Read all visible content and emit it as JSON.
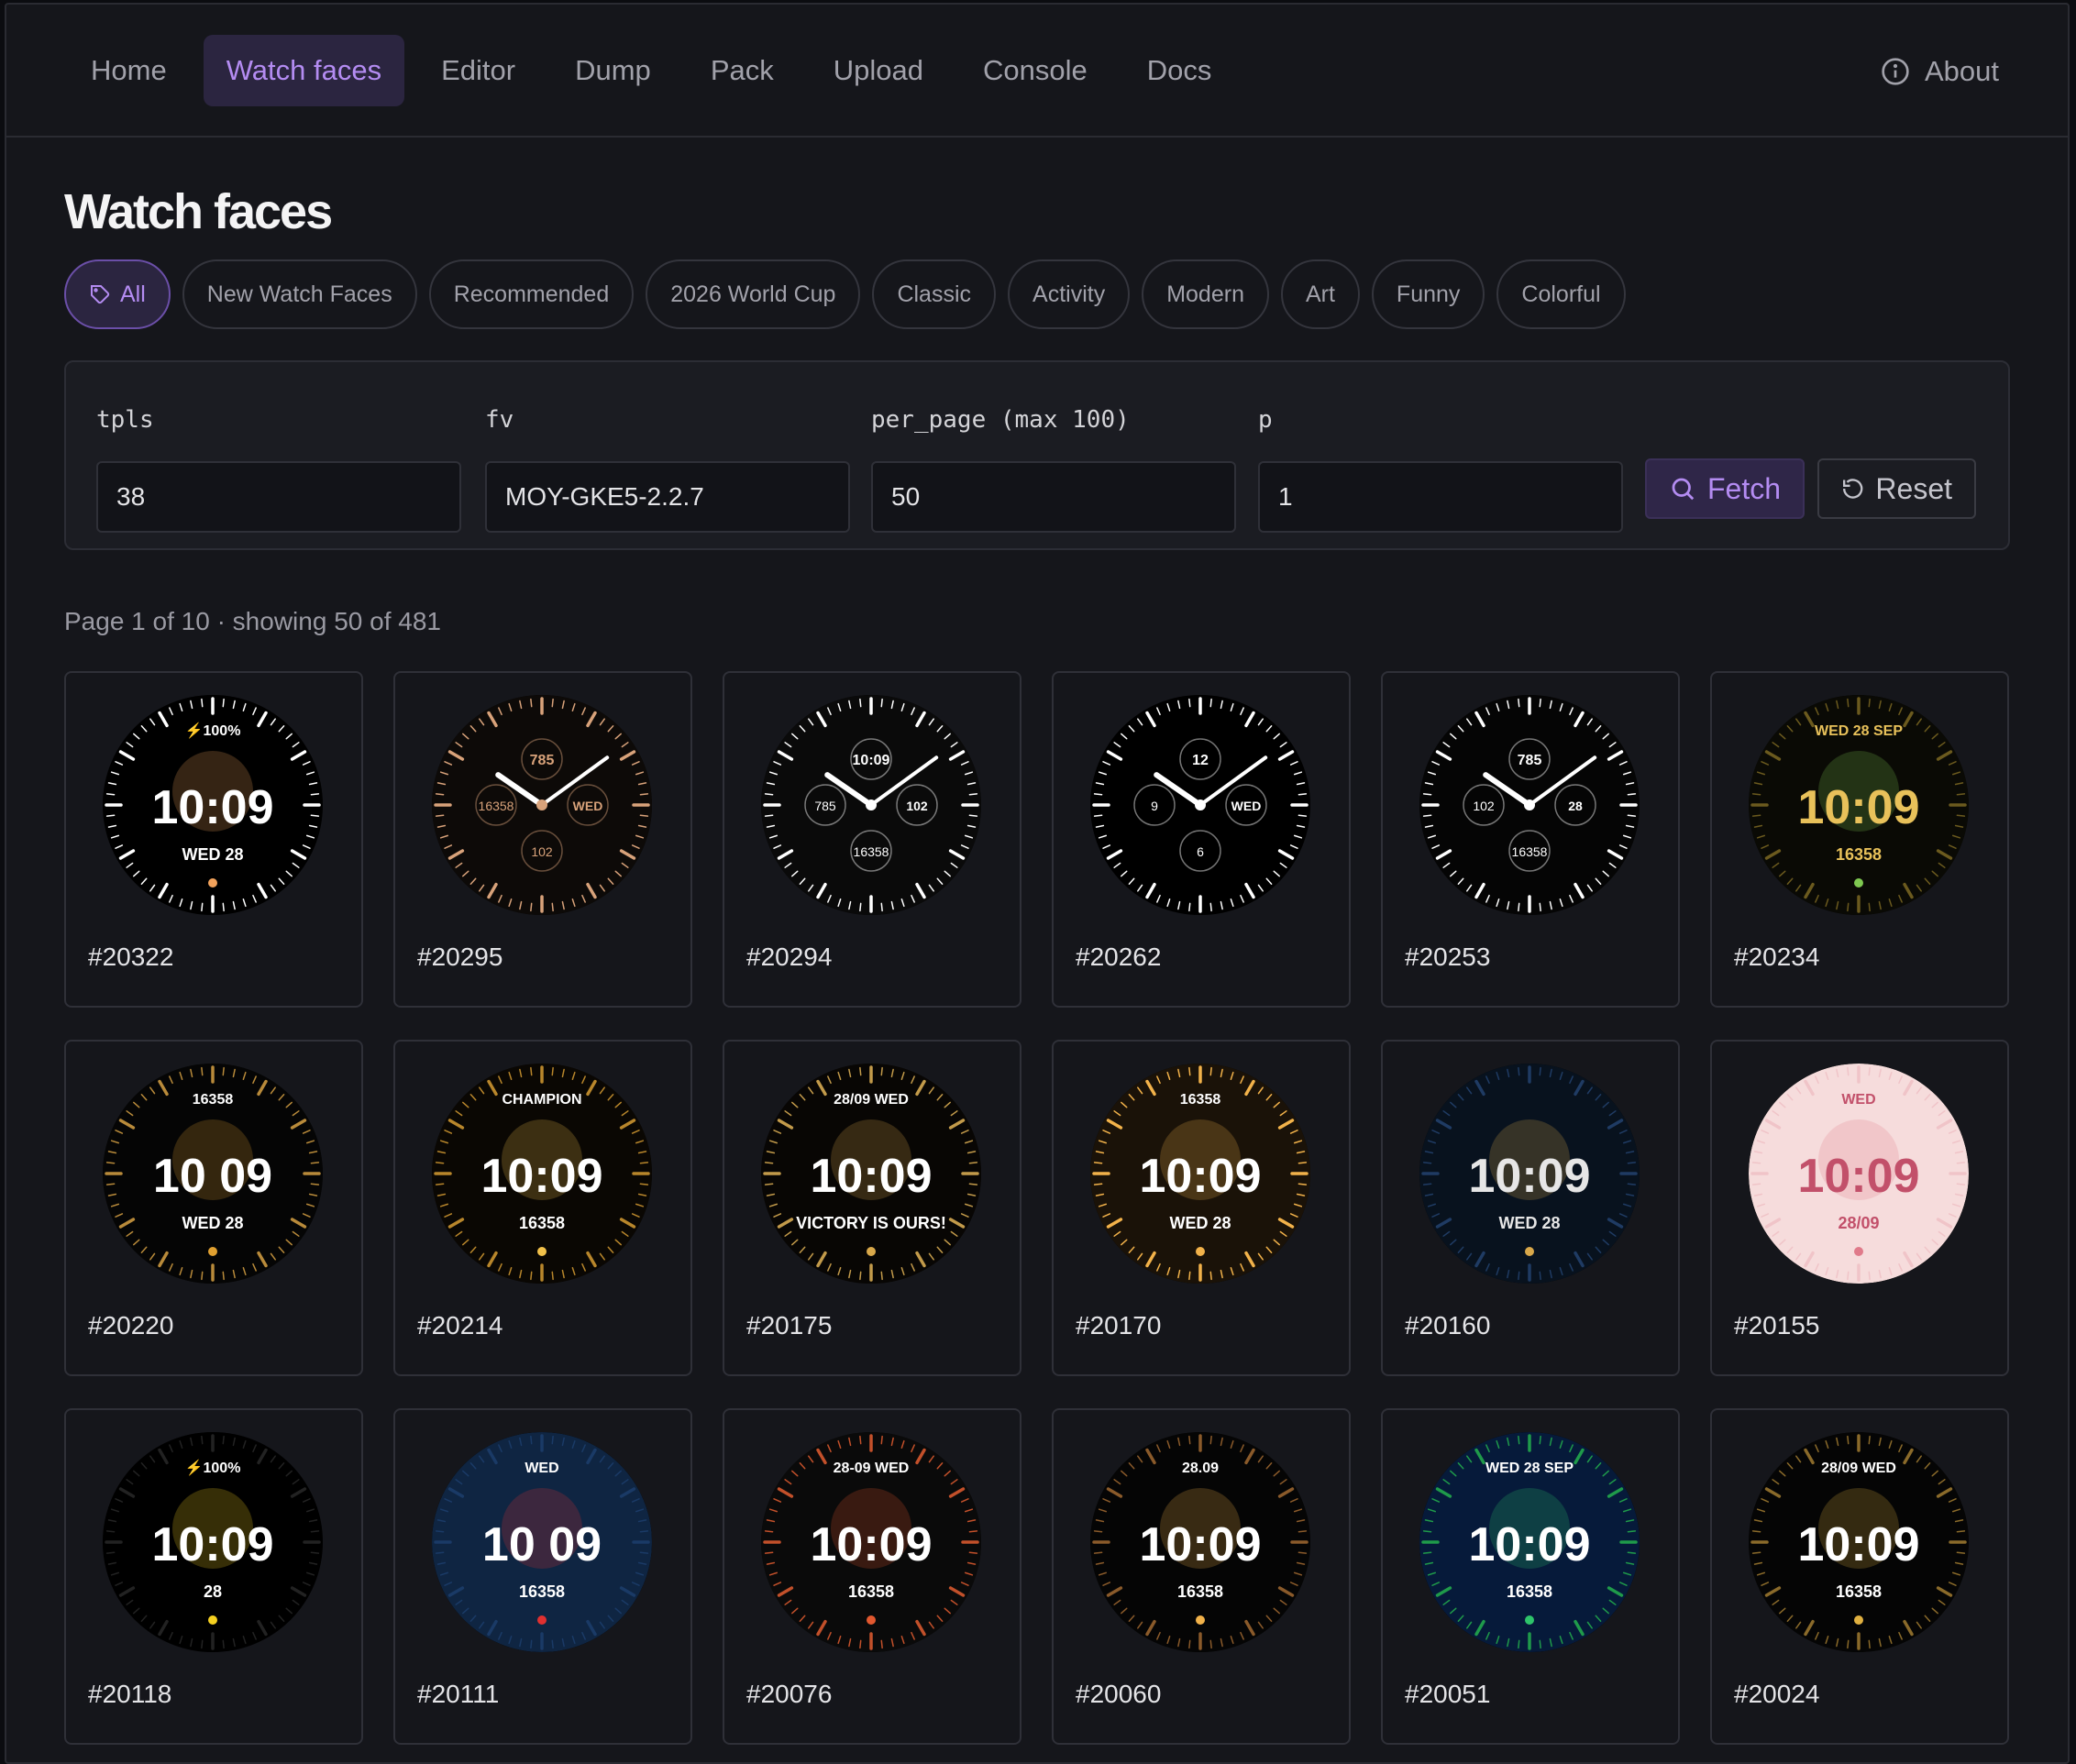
{
  "nav": {
    "items": [
      {
        "label": "Home",
        "active": false
      },
      {
        "label": "Watch faces",
        "active": true
      },
      {
        "label": "Editor",
        "active": false
      },
      {
        "label": "Dump",
        "active": false
      },
      {
        "label": "Pack",
        "active": false
      },
      {
        "label": "Upload",
        "active": false
      },
      {
        "label": "Console",
        "active": false
      },
      {
        "label": "Docs",
        "active": false
      }
    ],
    "about": "About"
  },
  "page": {
    "title": "Watch faces",
    "info": "Page 1 of 10 · showing 50 of 481"
  },
  "chips": [
    {
      "label": "All",
      "active": true
    },
    {
      "label": "New Watch Faces",
      "active": false
    },
    {
      "label": "Recommended",
      "active": false
    },
    {
      "label": "2026 World Cup",
      "active": false
    },
    {
      "label": "Classic",
      "active": false
    },
    {
      "label": "Activity",
      "active": false
    },
    {
      "label": "Modern",
      "active": false
    },
    {
      "label": "Art",
      "active": false
    },
    {
      "label": "Funny",
      "active": false
    },
    {
      "label": "Colorful",
      "active": false
    }
  ],
  "filters": {
    "tpls": {
      "label": "tpls",
      "value": "38"
    },
    "fv": {
      "label": "fv",
      "value": "MOY-GKE5-2.2.7"
    },
    "per_page": {
      "label": "per_page (max 100)",
      "value": "50"
    },
    "p": {
      "label": "p",
      "value": "1"
    },
    "fetch_label": "Fetch",
    "reset_label": "Reset"
  },
  "colors": {
    "accent": "#b48cf2",
    "accent_bg": "#2b2540",
    "background": "#15161b"
  },
  "faces": [
    {
      "id": "#20322",
      "kind": "digital",
      "bg": "#000000",
      "ring": "#ffffff",
      "fg": "#ffffff",
      "accent": "#f3a35c",
      "time": "10:09",
      "top": "⚡100%",
      "sub": "WED 28"
    },
    {
      "id": "#20295",
      "kind": "analog",
      "bg": "#0d0a08",
      "ring": "#d8a27a",
      "fg": "#d8a27a",
      "accent": "#ffffff",
      "top": "785",
      "left": "16358",
      "right": "WED",
      "bottom": "102"
    },
    {
      "id": "#20294",
      "kind": "analog",
      "bg": "#0a0a0a",
      "ring": "#ffffff",
      "fg": "#ffffff",
      "accent": "#ffffff",
      "top": "10:09",
      "left": "785",
      "right": "102",
      "bottom": "16358"
    },
    {
      "id": "#20262",
      "kind": "analog",
      "bg": "#000000",
      "ring": "#ffffff",
      "fg": "#ffffff",
      "accent": "#ffffff",
      "top": "12",
      "left": "9",
      "right": "WED",
      "bottom": "6"
    },
    {
      "id": "#20253",
      "kind": "analog",
      "bg": "#050505",
      "ring": "#ffffff",
      "fg": "#ffffff",
      "accent": "#ffffff",
      "top": "785",
      "left": "102",
      "right": "28",
      "bottom": "16358"
    },
    {
      "id": "#20234",
      "kind": "digital",
      "bg": "#0a0a05",
      "ring": "#6b5a1e",
      "fg": "#e8c15a",
      "accent": "#7ec850",
      "time": "10:09",
      "top": "WED 28 SEP",
      "sub": "16358"
    },
    {
      "id": "#20220",
      "kind": "digital",
      "bg": "#050505",
      "ring": "#b88a3a",
      "fg": "#ffffff",
      "accent": "#e0a030",
      "time": "10 09",
      "top": "16358",
      "sub": "WED 28"
    },
    {
      "id": "#20214",
      "kind": "digital",
      "bg": "#0a0703",
      "ring": "#b8862b",
      "fg": "#ffffff",
      "accent": "#f2c14a",
      "time": "10:09",
      "top": "CHAMPION",
      "sub": "16358"
    },
    {
      "id": "#20175",
      "kind": "digital",
      "bg": "#080604",
      "ring": "#c29a4a",
      "fg": "#ffffff",
      "accent": "#d9a84a",
      "time": "10:09",
      "top": "28/09 WED",
      "sub": "VICTORY IS OURS!"
    },
    {
      "id": "#20170",
      "kind": "digital",
      "bg": "#1a1208",
      "ring": "#f2b24a",
      "fg": "#ffffff",
      "accent": "#f2b24a",
      "time": "10:09",
      "top": "16358",
      "sub": "WED 28"
    },
    {
      "id": "#20160",
      "kind": "digital",
      "bg": "#08121e",
      "ring": "#1f3b63",
      "fg": "#e6e6e6",
      "accent": "#d9a84a",
      "time": "10:09",
      "top": "",
      "sub": "WED 28"
    },
    {
      "id": "#20155",
      "kind": "digital",
      "bg": "#f6dcdc",
      "ring": "#f0c4c8",
      "fg": "#c2506a",
      "accent": "#e07a8a",
      "time": "10:09",
      "top": "WED",
      "sub": "28/09"
    },
    {
      "id": "#20118",
      "kind": "digital",
      "bg": "#000000",
      "ring": "#222222",
      "fg": "#ffffff",
      "accent": "#f5d020",
      "time": "10:09",
      "top": "⚡100%",
      "sub": "28"
    },
    {
      "id": "#20111",
      "kind": "digital",
      "bg": "#0f2542",
      "ring": "#1a3a66",
      "fg": "#ffffff",
      "accent": "#e03030",
      "time": "10 09",
      "top": "WED",
      "sub": "16358"
    },
    {
      "id": "#20076",
      "kind": "digital",
      "bg": "#0a0a0a",
      "ring": "#c2502a",
      "fg": "#ffffff",
      "accent": "#e2582f",
      "time": "10:09",
      "top": "28-09 WED",
      "sub": "16358"
    },
    {
      "id": "#20060",
      "kind": "digital",
      "bg": "#050505",
      "ring": "#8a5a2a",
      "fg": "#ffffff",
      "accent": "#f2b24a",
      "time": "10:09",
      "top": "28.09",
      "sub": "16358"
    },
    {
      "id": "#20051",
      "kind": "digital",
      "bg": "#061a3a",
      "ring": "#1f9a4a",
      "fg": "#ffffff",
      "accent": "#2ec46a",
      "time": "10:09",
      "top": "WED 28 SEP",
      "sub": "16358"
    },
    {
      "id": "#20024",
      "kind": "digital",
      "bg": "#050505",
      "ring": "#8a6a2a",
      "fg": "#ffffff",
      "accent": "#e0b040",
      "time": "10:09",
      "top": "28/09 WED",
      "sub": "16358"
    }
  ]
}
